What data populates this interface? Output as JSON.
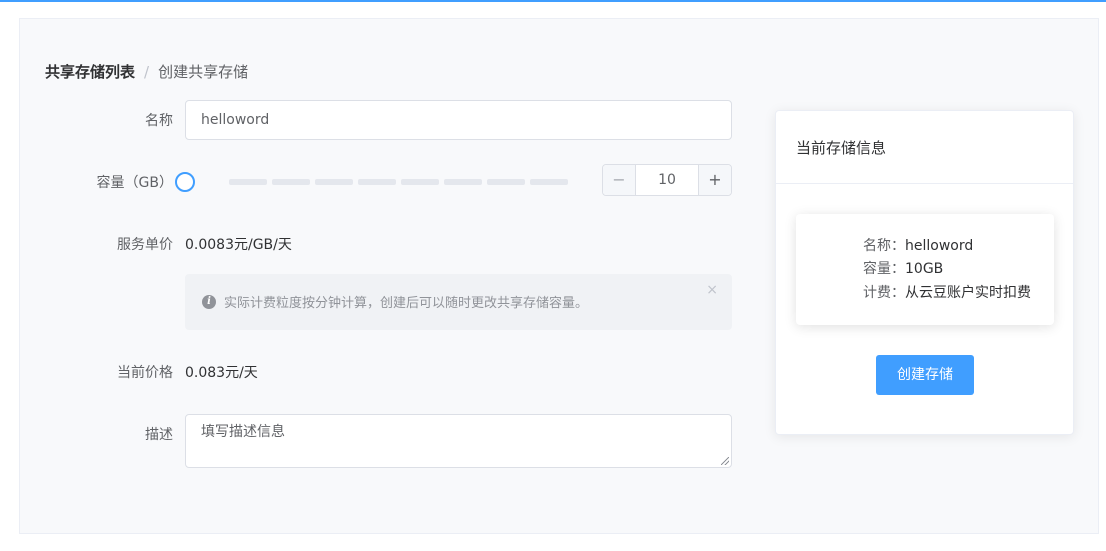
{
  "breadcrumb": {
    "parent": "共享存储列表",
    "separator": "/",
    "current": "创建共享存储"
  },
  "form": {
    "name_label": "名称",
    "name_value": "helloword",
    "capacity_label": "容量（GB）",
    "capacity_value": "10",
    "stepper_minus": "−",
    "stepper_plus": "+",
    "price_label": "服务单价",
    "price_value": "0.0083元/GB/天",
    "alert_icon": "i",
    "alert_text": "实际计费粒度按分钟计算，创建后可以随时更改共享存储容量。",
    "alert_close": "×",
    "current_price_label": "当前价格",
    "current_price_value": "0.083元/天",
    "description_label": "描述",
    "description_placeholder": "填写描述信息"
  },
  "card": {
    "title": "当前存储信息",
    "name_key": "名称：",
    "name_value": "helloword",
    "capacity_key": "容量：",
    "capacity_value": "10GB",
    "billing_key": "计费：",
    "billing_value": "从云豆账户实时扣费",
    "create_button": "创建存储"
  },
  "colors": {
    "accent": "#409eff",
    "border": "#dcdfe6",
    "panel_bg": "#f8f9fb"
  },
  "icons": {
    "info": "info-icon",
    "close": "close-icon"
  }
}
